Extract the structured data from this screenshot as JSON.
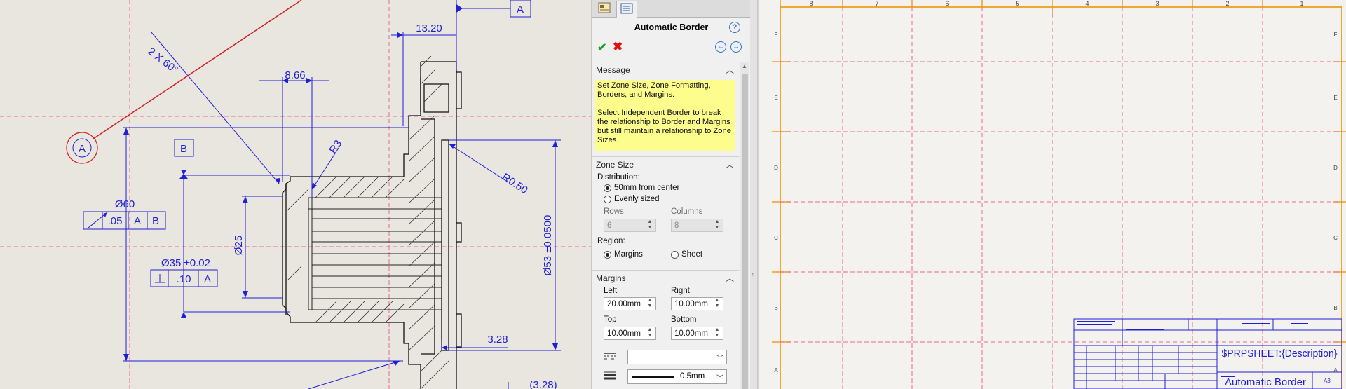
{
  "colors": {
    "drawing_blue": "#1f1fd6",
    "balloon_red": "#d42020",
    "grid_pink": "#e86a8c",
    "border_orange": "#f0a020",
    "sheet_bg": "#f3f2ee",
    "drawing_bg": "#e8e6df",
    "message_yellow": "#fdfd8e",
    "panel_bg": "#f0f0f0"
  },
  "panel": {
    "tabs": [
      {
        "icon": "property-manager-icon",
        "active": false
      },
      {
        "icon": "sheet-format-icon",
        "active": true
      }
    ],
    "title": "Automatic Border",
    "help_icon": "?",
    "ok_icon": "✔",
    "cancel_icon": "✖",
    "prev_icon": "←",
    "next_icon": "→",
    "message": {
      "header": "Message",
      "lines": [
        "Set Zone Size, Zone Formatting, Borders, and Margins.",
        "Select Independent Border to break the relationship to Border and Margins but still maintain a relationship to Zone Sizes."
      ]
    },
    "zone_size": {
      "header": "Zone Size",
      "distribution_label": "Distribution:",
      "options": [
        "50mm from center",
        "Evenly sized"
      ],
      "selected": "50mm from center",
      "rows_label": "Rows",
      "rows_value": "6",
      "columns_label": "Columns",
      "columns_value": "8",
      "region_label": "Region:",
      "region_options": [
        "Margins",
        "Sheet"
      ],
      "region_selected": "Margins"
    },
    "margins": {
      "header": "Margins",
      "left_label": "Left",
      "left_value": "20.00mm",
      "right_label": "Right",
      "right_value": "10.00mm",
      "top_label": "Top",
      "top_value": "10.00mm",
      "bottom_label": "Bottom",
      "bottom_value": "10.00mm",
      "line_style_value": "",
      "line_weight_value": "0.5mm"
    }
  },
  "drawing": {
    "dims": {
      "d_13_20": "13.20",
      "d_8_66": "8.66",
      "chamfer": "2 X 60°",
      "radius_r3": "R3",
      "radius_r050": "R0.50",
      "dia_60": "Ø60",
      "dia_25": "Ø25",
      "dia_35": "Ø35 ±0.02",
      "dia_53": "Ø53 ±0.0500",
      "d_3_28": "3.28",
      "d_3_28_lower": "(3.28)"
    },
    "datums": {
      "a": "A",
      "b": "B"
    },
    "balloon": "A",
    "fcf_position": {
      "value": ".05",
      "datum1": "A",
      "datum2": "B"
    },
    "fcf_perpendicular": {
      "value": ".10",
      "datum1": "A"
    }
  },
  "sheet": {
    "columns": [
      "8",
      "7",
      "6",
      "5",
      "4",
      "3",
      "2",
      "1"
    ],
    "rows": [
      "F",
      "E",
      "D",
      "C",
      "B",
      "A"
    ],
    "title_block": {
      "description": "$PRPSHEET:{Description}",
      "sheet_name": "Automatic Border",
      "size": "A3"
    }
  }
}
